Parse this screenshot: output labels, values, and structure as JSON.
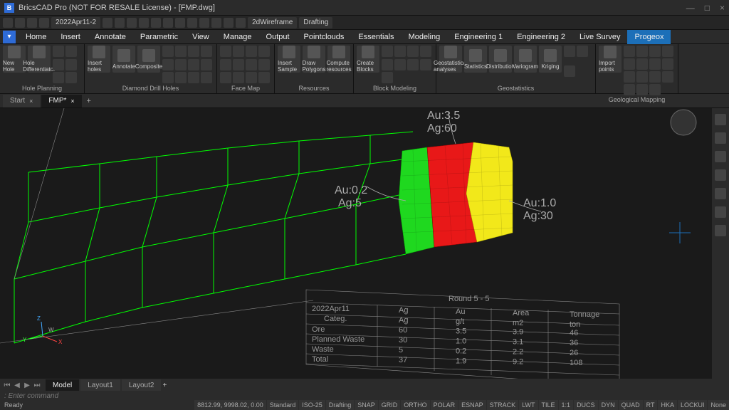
{
  "window": {
    "title": "BricsCAD Pro (NOT FOR RESALE License) - [FMP.dwg]",
    "logo": "B"
  },
  "qat": {
    "doc_dd": "2022Apr11-2",
    "view_dd": "2dWireframe",
    "ws_dd": "Drafting"
  },
  "menu": {
    "items": [
      "Home",
      "Insert",
      "Annotate",
      "Parametric",
      "View",
      "Manage",
      "Output",
      "Pointclouds",
      "Essentials",
      "Modeling",
      "Engineering 1",
      "Engineering 2",
      "Live Survey",
      "Progeox"
    ],
    "active": "Progeox"
  },
  "ribbon": {
    "groups": [
      {
        "label": "Hole Planning",
        "big": [
          {
            "t": "New Hole"
          },
          {
            "t": "Hole Differentiator"
          }
        ],
        "sm": 6
      },
      {
        "label": "Diamond Drill Holes",
        "big": [
          {
            "t": "Insert holes"
          },
          {
            "t": "Annotate"
          },
          {
            "t": "Composite"
          }
        ],
        "sm": 12
      },
      {
        "label": "Face Map",
        "big": [],
        "sm": 12
      },
      {
        "label": "Resources",
        "big": [
          {
            "t": "Insert Sample"
          },
          {
            "t": "Draw Polygons"
          },
          {
            "t": "Compute resources"
          }
        ],
        "sm": 0
      },
      {
        "label": "Block Modeling",
        "big": [
          {
            "t": "Create Blocks"
          }
        ],
        "sm": 9
      },
      {
        "label": "Geostatistics",
        "big": [
          {
            "t": "Geostatistical analyses"
          },
          {
            "t": "Statistics"
          },
          {
            "t": "Distribution"
          },
          {
            "t": "Variogram"
          },
          {
            "t": "Kriging"
          }
        ],
        "sm": 3
      },
      {
        "label": "Geological Mapping",
        "big": [
          {
            "t": "Import points"
          }
        ],
        "sm": 15
      }
    ]
  },
  "filetabs": {
    "tabs": [
      "Start",
      "FMP*"
    ],
    "active": 1
  },
  "annotations": {
    "top": {
      "au": "Au:3.5",
      "ag": "Ag:60"
    },
    "left": {
      "au": "Au:0.2",
      "ag": "Ag:5"
    },
    "right": {
      "au": "Au:1.0",
      "ag": "Ag:30"
    }
  },
  "chart_data": {
    "type": "table",
    "title": "Round 5 - 5",
    "date": "2022Apr11",
    "columns": [
      "Categ.",
      "Ag",
      "Au",
      "Area",
      "Tonnage"
    ],
    "units": [
      "",
      "Ag",
      "g/t",
      "m2",
      "ton"
    ],
    "rows": [
      {
        "c": "Ore",
        "ag": "60",
        "au": "3.5",
        "area": "3.9",
        "ton": "46"
      },
      {
        "c": "Planned Waste",
        "ag": "30",
        "au": "1.0",
        "area": "3.1",
        "ton": "36"
      },
      {
        "c": "Waste",
        "ag": "5",
        "au": "0.2",
        "area": "2.2",
        "ton": "26"
      },
      {
        "c": "Total",
        "ag": "37",
        "au": "1.9",
        "area": "9.2",
        "ton": "108"
      }
    ]
  },
  "modeltabs": {
    "tabs": [
      "Model",
      "Layout1",
      "Layout2"
    ],
    "active": 0
  },
  "cmd": {
    "prompt": ": Enter command"
  },
  "status": {
    "left": "Ready",
    "coords": "8812.99, 9998.02, 0.00",
    "std": "Standard",
    "iso": "ISO-25",
    "flags": [
      "Drafting",
      "SNAP",
      "GRID",
      "ORTHO",
      "POLAR",
      "ESNAP",
      "STRACK",
      "LWT",
      "TILE",
      "1:1",
      "DUCS",
      "DYN",
      "QUAD",
      "RT",
      "HKA",
      "LOCKUI",
      "None"
    ]
  }
}
